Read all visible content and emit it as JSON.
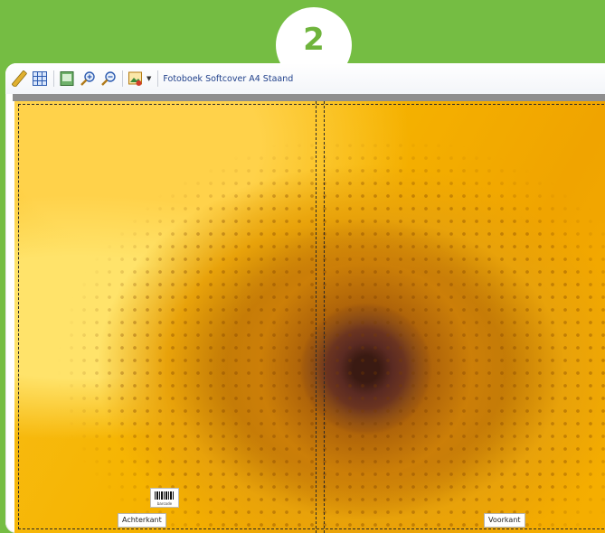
{
  "step": {
    "number": "2"
  },
  "toolbar": {
    "buttons": [
      {
        "name": "ruler-icon"
      },
      {
        "name": "grid-icon"
      },
      {
        "name": "page-view-icon"
      },
      {
        "name": "zoom-in-icon"
      },
      {
        "name": "zoom-out-icon"
      },
      {
        "name": "image-tools-icon"
      }
    ],
    "product_label": "Fotoboek Softcover A4 Staand"
  },
  "cover": {
    "back_label": "Achterkant",
    "front_label": "Voorkant",
    "barcode_text": "barcode"
  },
  "colors": {
    "background": "#75bd43",
    "badge_text": "#6fb43c",
    "label_text": "#1f3f8a"
  }
}
